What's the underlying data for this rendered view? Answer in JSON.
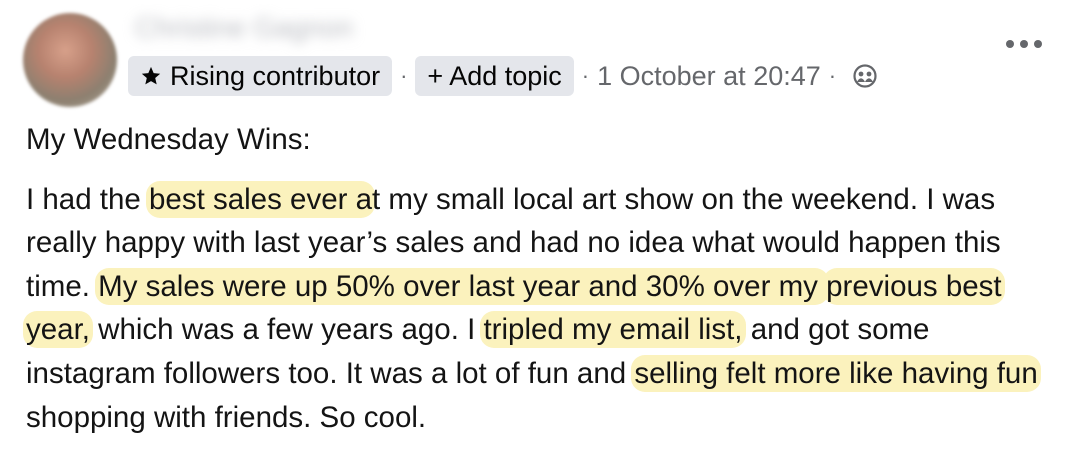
{
  "post": {
    "author_name": "Christine Gagnon",
    "badge_label": "Rising contributor",
    "add_topic_label": "+ Add topic",
    "separator": "·",
    "timestamp": "1 October at 20:47",
    "intro": "My Wednesday Wins:",
    "body_segments": [
      {
        "text": "I had the ",
        "highlight": false
      },
      {
        "text": "best sales ever a",
        "highlight": true
      },
      {
        "text": "t my small local art show on the weekend.  I was really happy with last year’s sales and had no idea what would happen this time.  ",
        "highlight": false
      },
      {
        "text": "My sales were up 50% over last year and 30% over my ",
        "highlight": true
      },
      {
        "text": "previous best year,",
        "highlight": true
      },
      {
        "text": " which was a few years ago.  I ",
        "highlight": false
      },
      {
        "text": "tripled my email list,",
        "highlight": true
      },
      {
        "text": " and got some instagram followers too.  It was a lot of fun and ",
        "highlight": false
      },
      {
        "text": "selling felt more like having fun",
        "highlight": true
      },
      {
        "text": " shopping with friends.  So cool.",
        "highlight": false
      }
    ]
  },
  "icons": {
    "badge": "star-icon",
    "audience": "globe-people-icon",
    "menu": "more-dots-icon"
  },
  "colors": {
    "highlight": "#fbf2bd",
    "chip_bg": "#e4e6eb",
    "meta_text": "#65676b"
  }
}
